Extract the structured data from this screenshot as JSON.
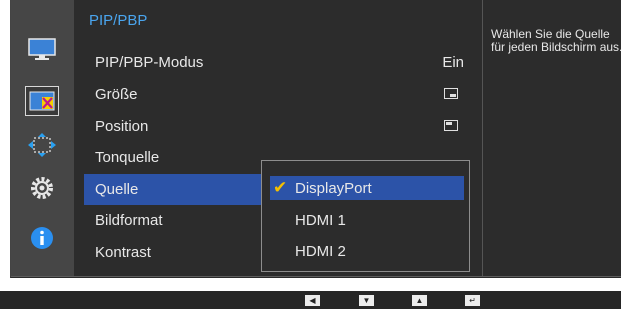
{
  "menu": {
    "title": "PIP/PBP",
    "items": [
      {
        "label": "PIP/PBP-Modus",
        "value": "Ein"
      },
      {
        "label": "Größe",
        "icon": "size-small-window-icon"
      },
      {
        "label": "Position",
        "icon": "position-top-left-icon"
      },
      {
        "label": "Tonquelle"
      },
      {
        "label": "Quelle",
        "selected": true
      },
      {
        "label": "Bildformat"
      },
      {
        "label": "Kontrast"
      }
    ]
  },
  "submenu": {
    "items": [
      {
        "label": "DisplayPort",
        "selected": true
      },
      {
        "label": "HDMI 1"
      },
      {
        "label": "HDMI 2"
      }
    ],
    "check_icon": "checkmark-icon"
  },
  "help": {
    "text": "Wählen Sie die Quelle für jeden Bildschirm aus."
  },
  "sidebar_icons": [
    "monitor-icon",
    "pip-pbp-icon",
    "resize-arrows-icon",
    "settings-gear-icon",
    "info-icon"
  ],
  "nav_icons": [
    "left-arrow-icon",
    "down-arrow-icon",
    "up-arrow-icon",
    "enter-icon"
  ],
  "colors": {
    "accent_blue": "#4aa5ee",
    "highlight": "#2c53a8",
    "check": "#f5c000"
  }
}
